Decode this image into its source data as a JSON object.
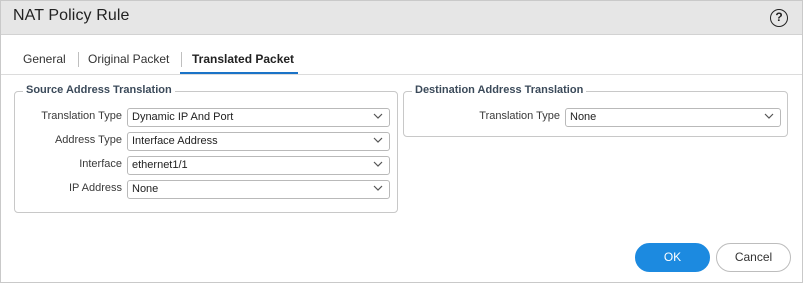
{
  "dialog": {
    "title": "NAT Policy Rule",
    "help_label": "?"
  },
  "tabs": [
    {
      "label": "General",
      "active": false
    },
    {
      "label": "Original Packet",
      "active": false
    },
    {
      "label": "Translated Packet",
      "active": true
    }
  ],
  "source": {
    "legend": "Source Address Translation",
    "rows": [
      {
        "label": "Translation Type",
        "value": "Dynamic IP And Port"
      },
      {
        "label": "Address Type",
        "value": "Interface Address"
      },
      {
        "label": "Interface",
        "value": "ethernet1/1"
      },
      {
        "label": "IP Address",
        "value": "None"
      }
    ]
  },
  "destination": {
    "legend": "Destination Address Translation",
    "rows": [
      {
        "label": "Translation Type",
        "value": "None"
      }
    ]
  },
  "buttons": {
    "ok": "OK",
    "cancel": "Cancel"
  },
  "colors": {
    "accent": "#1a73c7",
    "ok_button": "#1c8ae0"
  }
}
